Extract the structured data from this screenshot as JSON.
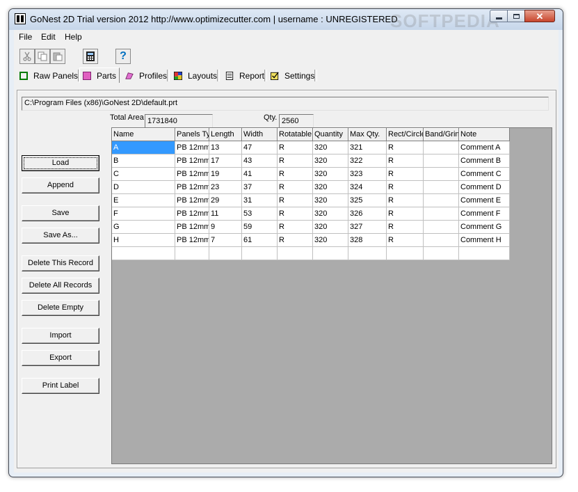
{
  "window": {
    "title": "GoNest 2D Trial version  2012  http://www.optimizecutter.com | username : UNREGISTERED",
    "watermark": "SOFTPEDIA"
  },
  "menu": [
    "File",
    "Edit",
    "Help"
  ],
  "toolbar": {
    "cut_icon": "scissors-icon",
    "copy_icon": "copy-icon",
    "paste_icon": "paste-icon",
    "calc_icon": "calculator-icon",
    "help_label": "?"
  },
  "tabs": [
    {
      "label": "Raw Panels",
      "icon": "square-icon"
    },
    {
      "label": "Parts",
      "icon": "parts-icon"
    },
    {
      "label": "Profiles",
      "icon": "profile-icon"
    },
    {
      "label": "Layouts",
      "icon": "layout-icon"
    },
    {
      "label": "Report",
      "icon": "report-icon"
    },
    {
      "label": "Settings",
      "icon": "settings-icon"
    }
  ],
  "active_tab": "Parts",
  "file_path": "C:\\Program Files (x86)\\GoNest 2D\\default.prt",
  "total_area": {
    "label": "Total Area",
    "value": "1731840"
  },
  "qty": {
    "label": "Qty.",
    "value": "2560"
  },
  "buttons": {
    "load": "Load",
    "append": "Append",
    "save": "Save",
    "save_as": "Save As...",
    "delete_record": "Delete This Record",
    "delete_all": "Delete All Records",
    "delete_empty": "Delete Empty",
    "import": "Import",
    "export": "Export",
    "print_label": "Print Label"
  },
  "grid": {
    "columns": [
      "Name",
      "Panels Ty",
      "Length",
      "Width",
      "Rotatable",
      "Quantity",
      "Max Qty.",
      "Rect/Circle",
      "Band/Grind",
      "Note"
    ],
    "rows": [
      [
        "A",
        "PB  12mm",
        "13",
        "47",
        "R",
        "320",
        "321",
        "R",
        "",
        "Comment A"
      ],
      [
        "B",
        "PB  12mm",
        "17",
        "43",
        "R",
        "320",
        "322",
        "R",
        "",
        "Comment B"
      ],
      [
        "C",
        "PB  12mm",
        "19",
        "41",
        "R",
        "320",
        "323",
        "R",
        "",
        "Comment C"
      ],
      [
        "D",
        "PB  12mm",
        "23",
        "37",
        "R",
        "320",
        "324",
        "R",
        "",
        "Comment D"
      ],
      [
        "E",
        "PB  12mm",
        "29",
        "31",
        "R",
        "320",
        "325",
        "R",
        "",
        "Comment E"
      ],
      [
        "F",
        "PB  12mm",
        "11",
        "53",
        "R",
        "320",
        "326",
        "R",
        "",
        "Comment F"
      ],
      [
        "G",
        "PB  12mm",
        "9",
        "59",
        "R",
        "320",
        "327",
        "R",
        "",
        "Comment G"
      ],
      [
        "H",
        "PB  12mm",
        "7",
        "61",
        "R",
        "320",
        "328",
        "R",
        "",
        "Comment H"
      ],
      [
        "",
        "",
        "",
        "",
        "",
        "",
        "",
        "",
        "",
        ""
      ]
    ]
  }
}
